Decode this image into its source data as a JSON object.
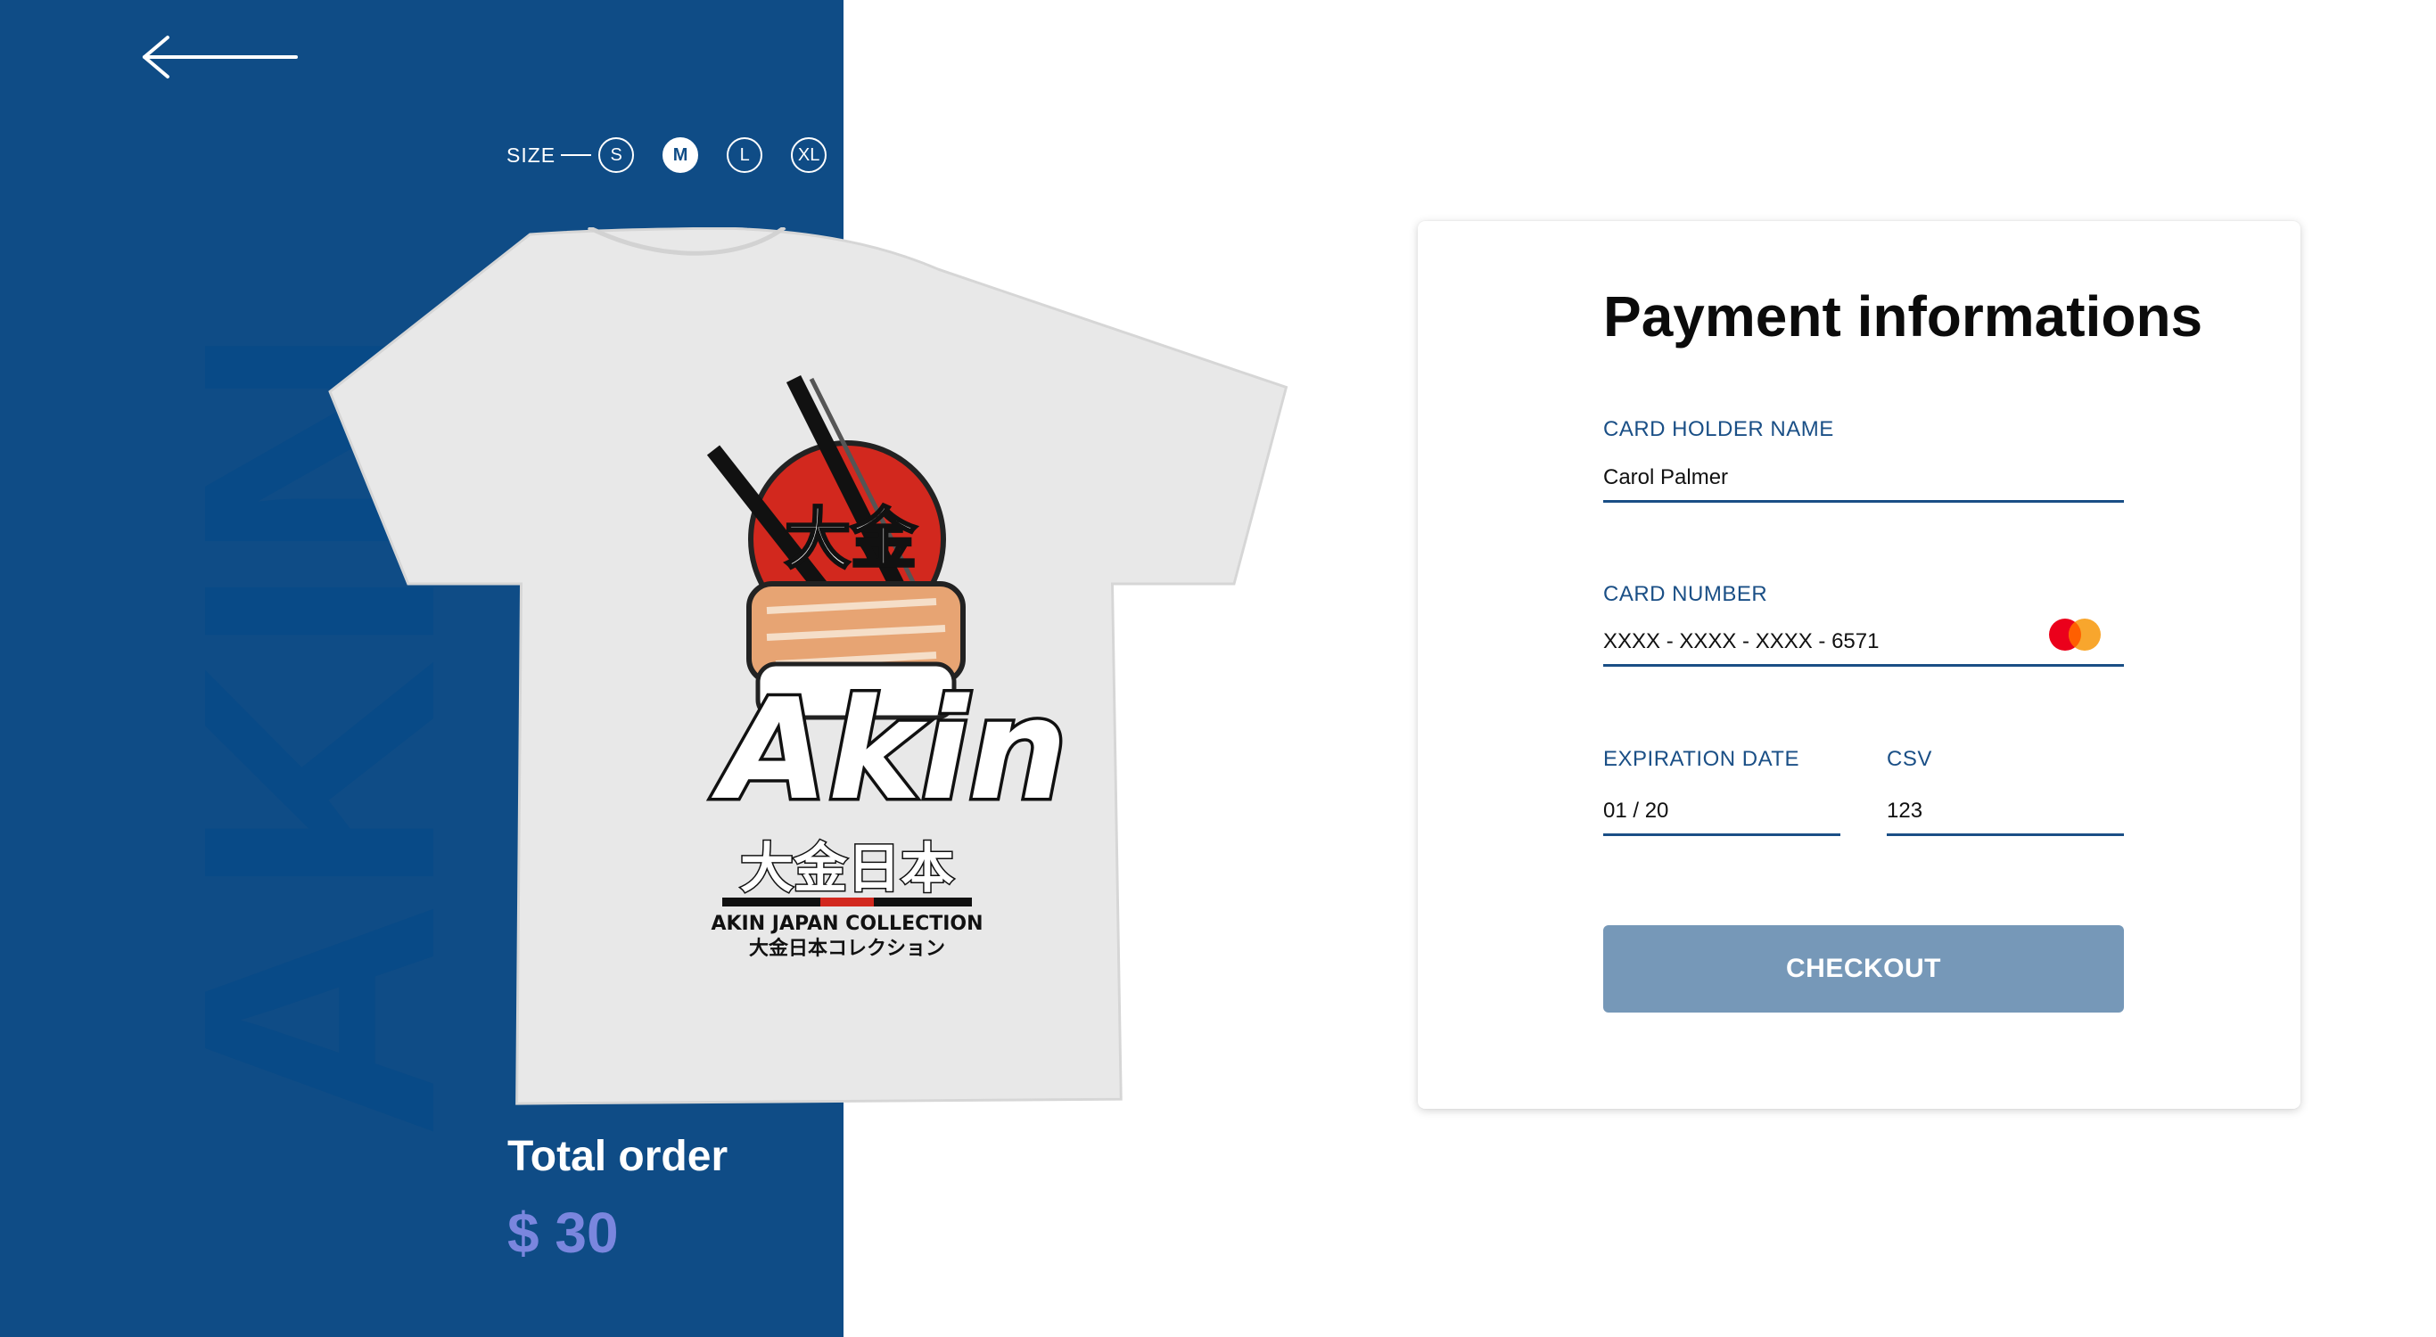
{
  "brand": {
    "watermark": "AKIN",
    "accent_color": "#0f4c86"
  },
  "nav": {
    "back_icon": "arrow-left-icon"
  },
  "product": {
    "size_label": "SIZE",
    "sizes": [
      "S",
      "M",
      "L",
      "XL"
    ],
    "selected_size": "M",
    "shirt_print": {
      "logo_text": "Akin",
      "kanji_top": "大金",
      "kanji_bottom": "大金日本",
      "collection": "AKIN JAPAN COLLECTION",
      "katakana": "大金日本コレクション"
    }
  },
  "order": {
    "total_label": "Total order",
    "total_value": "$ 30"
  },
  "payment": {
    "title": "Payment informations",
    "card_holder": {
      "label": "CARD HOLDER NAME",
      "value": "Carol Palmer"
    },
    "card_number": {
      "label": "CARD NUMBER",
      "value": "XXXX - XXXX - XXXX - 6571",
      "brand_icon": "mastercard-icon"
    },
    "expiration": {
      "label": "EXPIRATION DATE",
      "value": "01 / 20"
    },
    "csv": {
      "label": "CSV",
      "value": "123"
    },
    "checkout_label": "CHECKOUT"
  }
}
